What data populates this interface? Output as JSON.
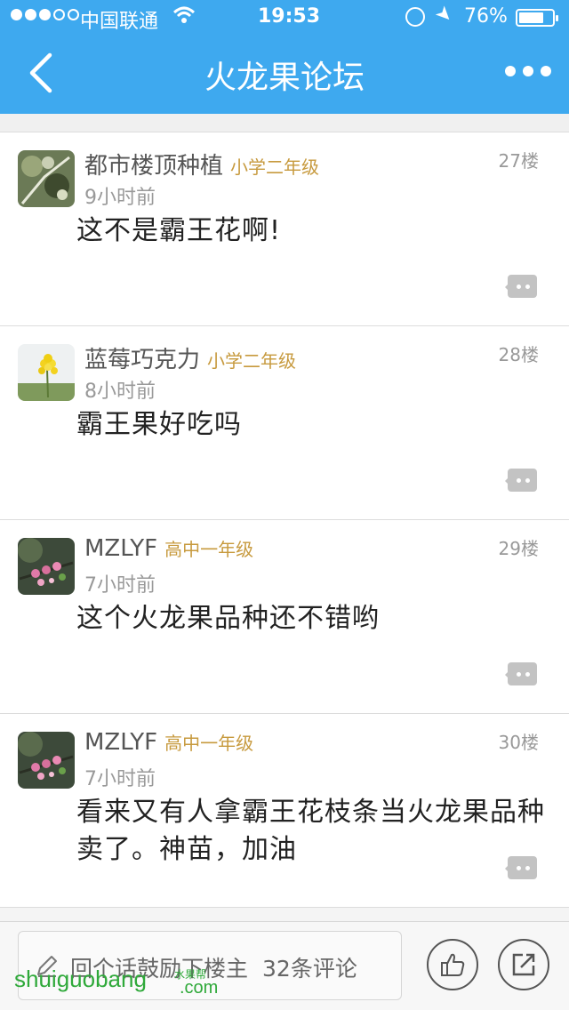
{
  "status_bar": {
    "carrier": "中国联通",
    "time": "19:53",
    "battery_pct": "76%",
    "battery_level": 0.76,
    "signal_bars": 3
  },
  "nav": {
    "title": "火龙果论坛",
    "back_icon": "chevron-left-icon",
    "more_icon": "more-dots-icon"
  },
  "posts": [
    {
      "username": "都市楼顶种植",
      "grade": "小学二年级",
      "time": "9小时前",
      "floor": "27楼",
      "content": "这不是霸王花啊!"
    },
    {
      "username": "蓝莓巧克力",
      "grade": "小学二年级",
      "time": "8小时前",
      "floor": "28楼",
      "content": "霸王果好吃吗"
    },
    {
      "username": "MZLYF",
      "grade": "高中一年级",
      "time": "7小时前",
      "floor": "29楼",
      "content": "这个火龙果品种还不错哟"
    },
    {
      "username": "MZLYF",
      "grade": "高中一年级",
      "time": "7小时前",
      "floor": "30楼",
      "content": "看来又有人拿霸王花枝条当火龙果品种卖了。神苗，加油"
    }
  ],
  "bottom_bar": {
    "placeholder": "回个话鼓励下楼主",
    "comment_count": "32条评论",
    "like_icon": "thumbs-up-icon",
    "share_icon": "share-icon"
  },
  "watermark": {
    "text": "shuiguobang",
    "small": "水果帮",
    "com": ".com"
  },
  "colors": {
    "header": "#3ea9ef",
    "grade": "#c79a3e",
    "watermark": "#2fa93a"
  }
}
